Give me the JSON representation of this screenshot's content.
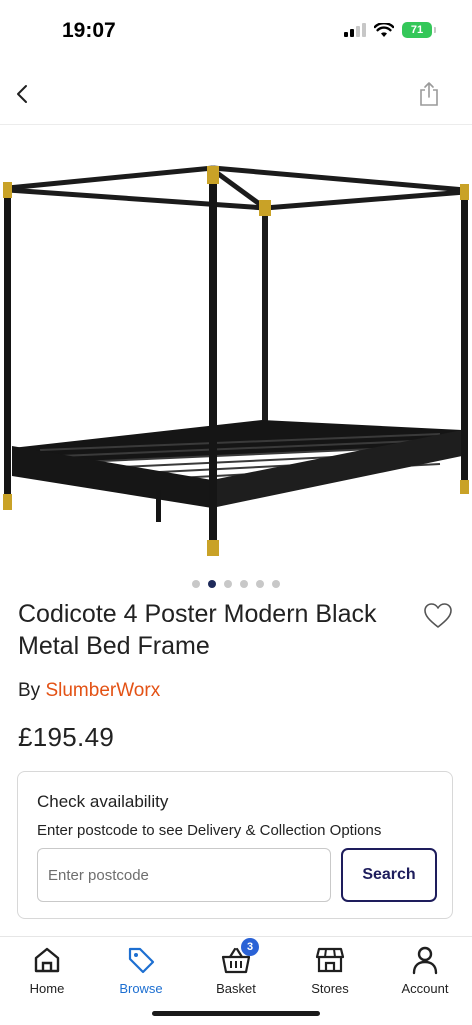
{
  "status_bar": {
    "time": "19:07",
    "battery": "71"
  },
  "product": {
    "title": "Codicote 4 Poster Modern Black Metal Bed Frame",
    "by_prefix": "By",
    "brand": "SlumberWorx",
    "price": "£195.49",
    "image_count": 6,
    "active_image": 1
  },
  "availability": {
    "heading": "Check availability",
    "subtext": "Enter postcode to see Delivery & Collection Options",
    "postcode_placeholder": "Enter postcode",
    "postcode_value": "",
    "search_label": "Search"
  },
  "tab_bar": {
    "items": [
      {
        "label": "Home",
        "icon": "home-icon"
      },
      {
        "label": "Browse",
        "icon": "tag-icon",
        "active": true
      },
      {
        "label": "Basket",
        "icon": "basket-icon",
        "badge": "3"
      },
      {
        "label": "Stores",
        "icon": "store-icon"
      },
      {
        "label": "Account",
        "icon": "account-icon"
      }
    ]
  },
  "colors": {
    "brand_link": "#e35215",
    "accent_blue": "#1d6fd1",
    "button_navy": "#1e1d5c",
    "battery_green": "#34c759"
  }
}
